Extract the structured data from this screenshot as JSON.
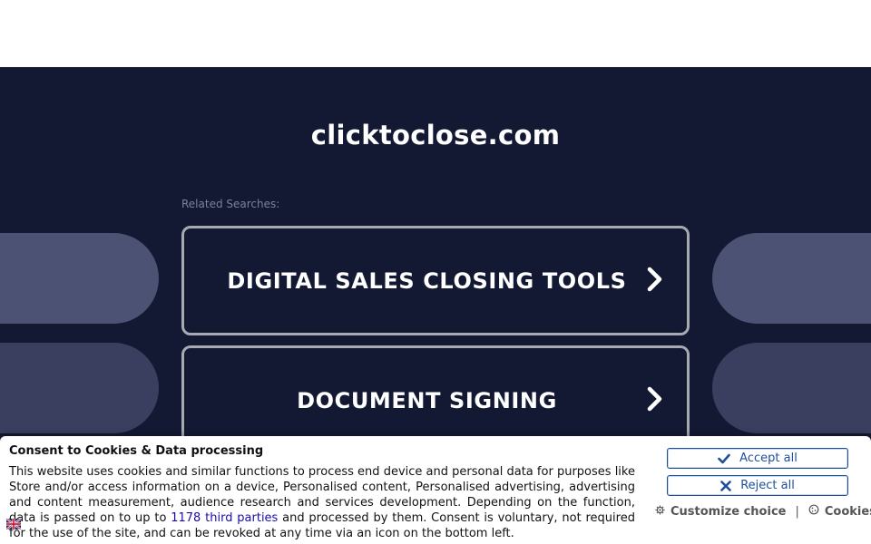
{
  "page": {
    "domain": "clicktoclose.com",
    "related_label": "Related Searches:"
  },
  "searches": [
    {
      "label": "DIGITAL SALES CLOSING TOOLS"
    },
    {
      "label": "DOCUMENT SIGNING"
    }
  ],
  "consent": {
    "title": "Consent to Cookies & Data processing",
    "text_before_link": "This website uses cookies and similar functions to process end device and personal data for purposes like Store and/or access information on a device, Personalised content, Personalised advertising, advertising and content measurement, audience research and services development. Depending on the function, data is passed on to up to ",
    "link_text": "1178 third parties",
    "text_after_link": " and processed by them. Consent is voluntary, not required for the use of the site, and can be revoked at any time via an icon on the bottom left.",
    "accept_label": "Accept all",
    "reject_label": "Reject all",
    "customize_label": "Customize choice",
    "separator": "|",
    "cookies_label": "Cookies",
    "language_icon": "uk-flag-icon"
  },
  "colors": {
    "background": "#141933",
    "button_border": "#a7a9b3",
    "consent_accent": "#1f4f9a",
    "link": "#1a0dab"
  }
}
